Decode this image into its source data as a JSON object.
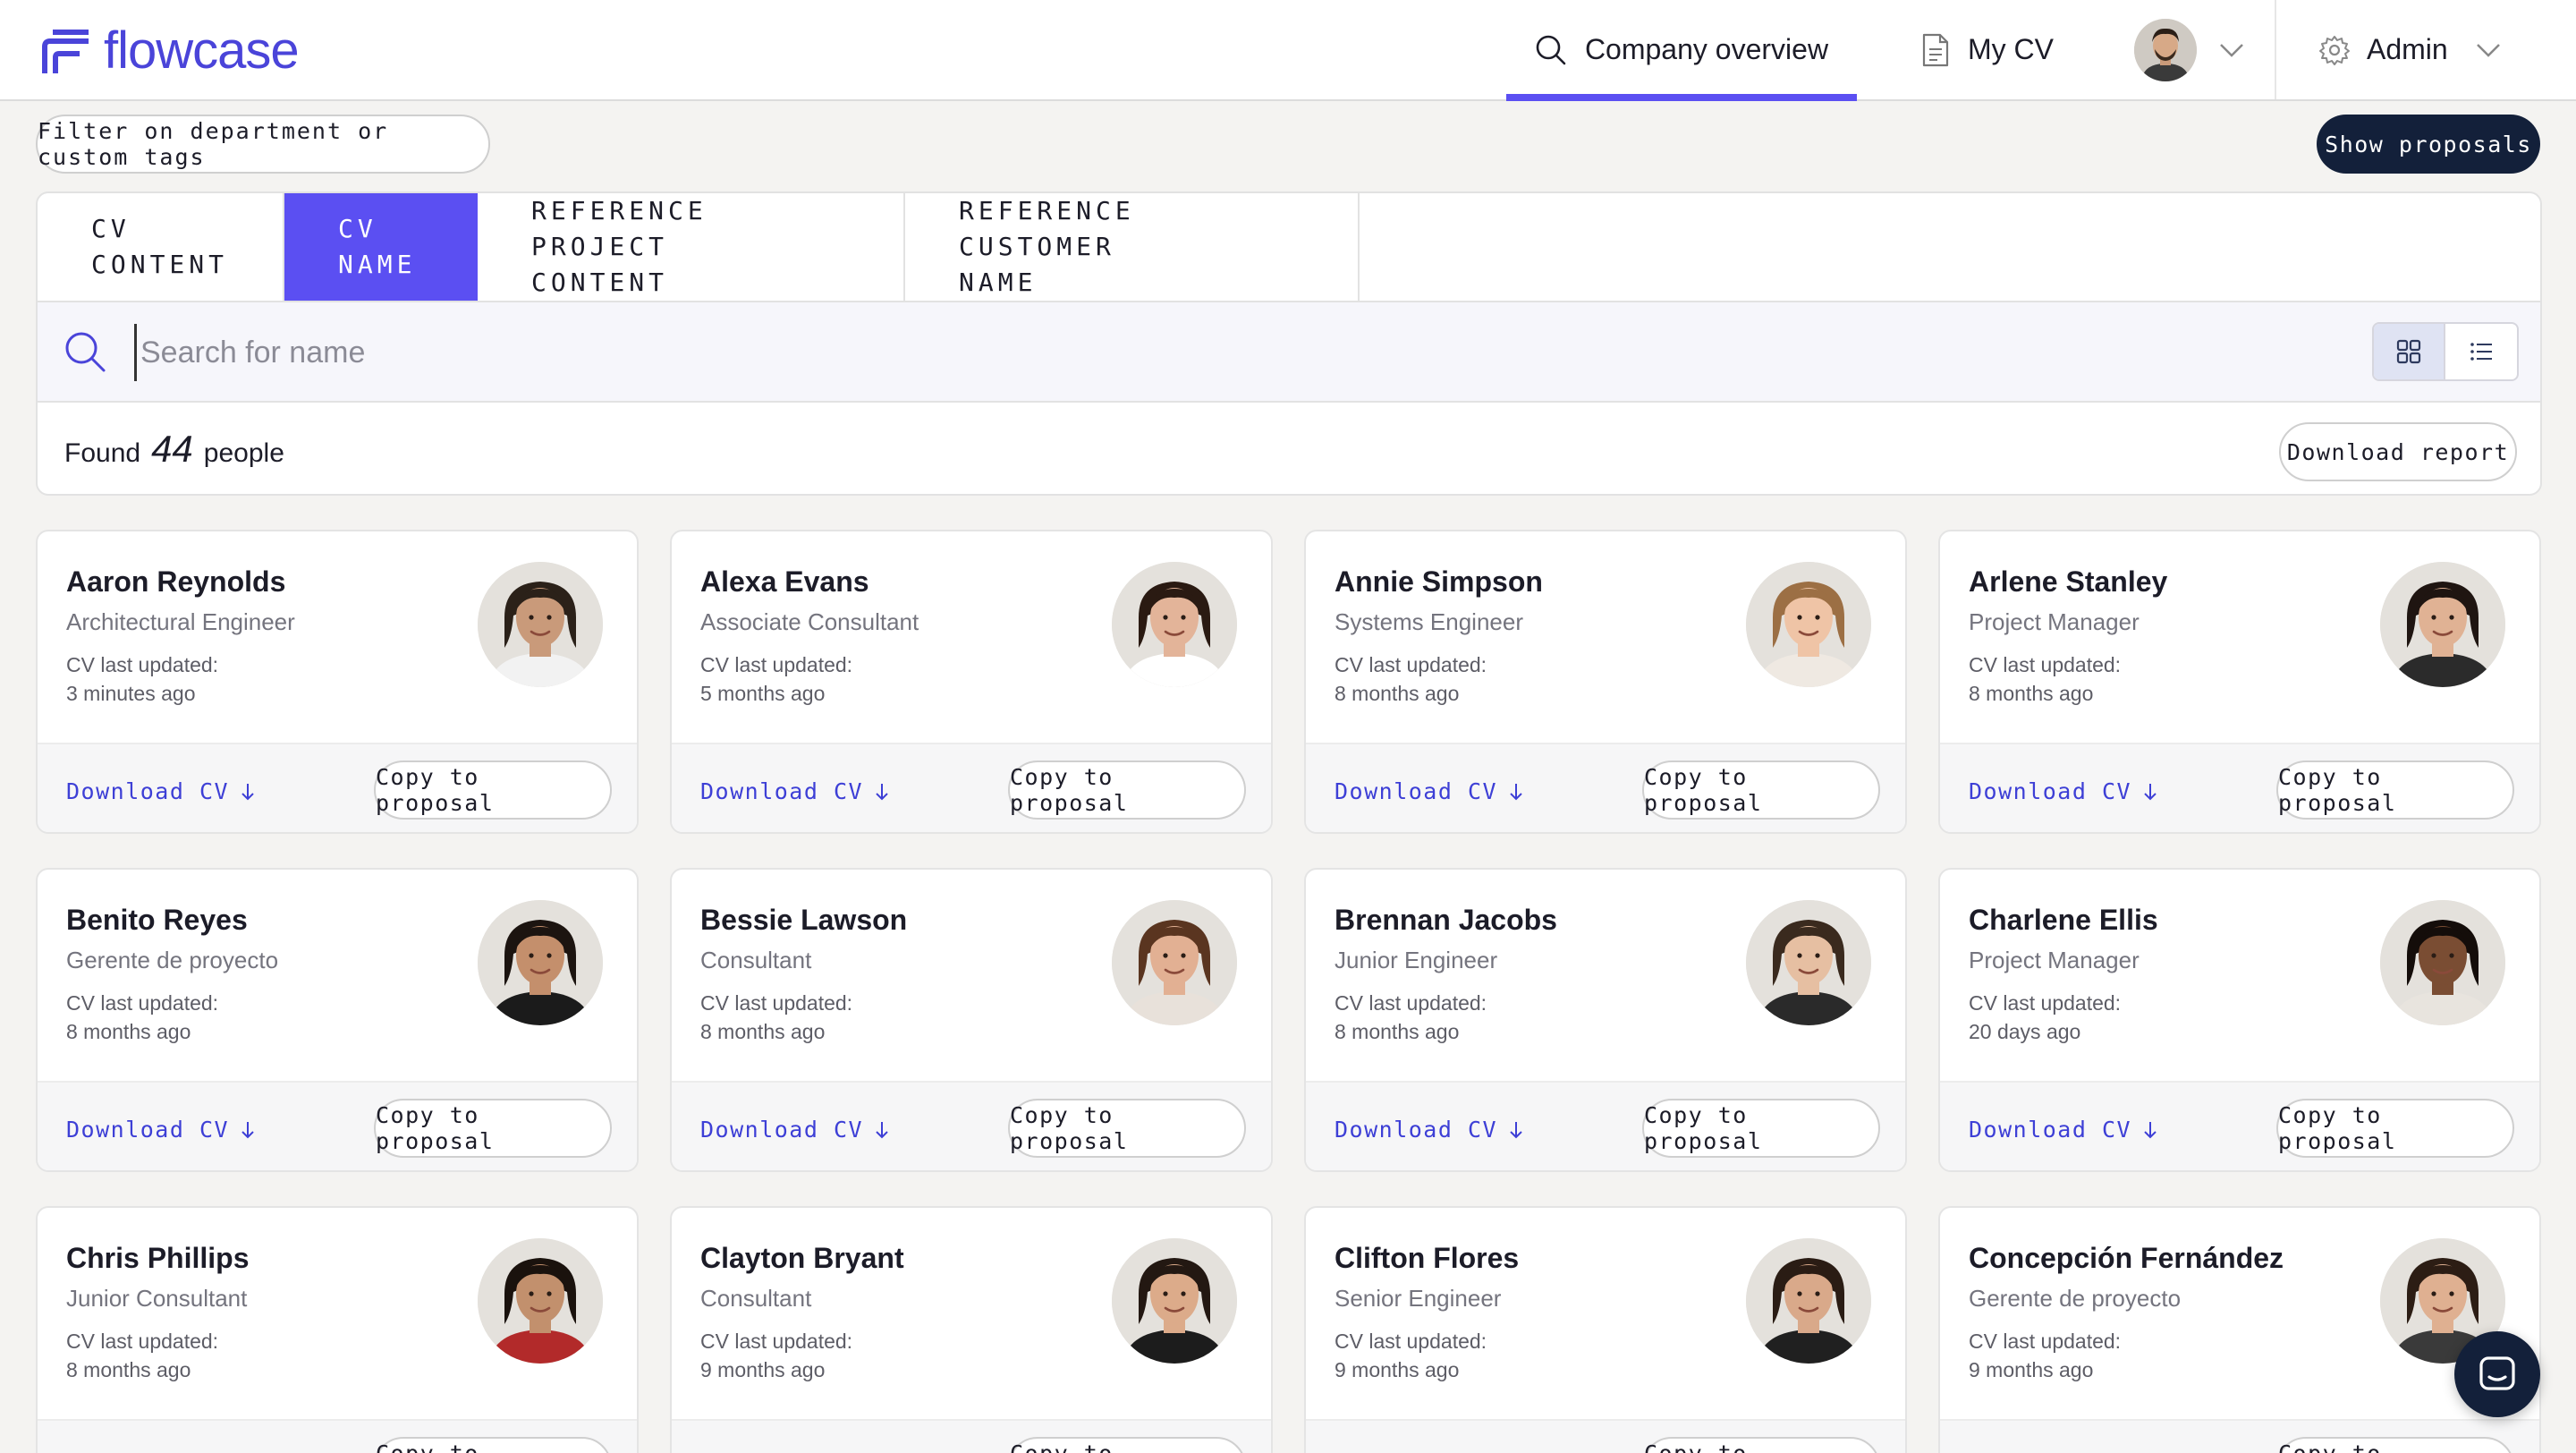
{
  "app": {
    "logo_text": "flowcase",
    "brand_color": "#5b4ff2"
  },
  "nav": {
    "company_overview": "Company overview",
    "my_cv": "My CV",
    "admin": "Admin"
  },
  "toolbar": {
    "filter_label": "Filter on department or custom tags",
    "show_proposals": "Show proposals"
  },
  "search": {
    "tabs": [
      {
        "line1": "CV",
        "line2": "CONTENT"
      },
      {
        "line1": "CV",
        "line2": "NAME"
      },
      {
        "line1": "REFERENCE PROJECT",
        "line2": "CONTENT"
      },
      {
        "line1": "REFERENCE CUSTOMER",
        "line2": "NAME"
      }
    ],
    "active_tab": 1,
    "placeholder": "Search for name",
    "value": "",
    "active_view": "grid"
  },
  "results": {
    "found_prefix": "Found",
    "count": "44",
    "found_suffix": "people",
    "download_report": "Download report"
  },
  "card_labels": {
    "cv_last_updated": "CV last updated:",
    "download_cv": "Download CV",
    "copy_to_proposal": "Copy to proposal"
  },
  "people": [
    {
      "name": "Aaron Reynolds",
      "role": "Architectural Engineer",
      "updated": "3 minutes ago",
      "skin": "#c99a7a",
      "hair": "#2b2119",
      "shirt": "#f2f2f2"
    },
    {
      "name": "Alexa Evans",
      "role": "Associate Consultant",
      "updated": "5 months ago",
      "skin": "#e3b499",
      "hair": "#2a1a12",
      "shirt": "#ffffff"
    },
    {
      "name": "Annie Simpson",
      "role": "Systems Engineer",
      "updated": "8 months ago",
      "skin": "#efc4a6",
      "hair": "#9c6f44",
      "shirt": "#efe9e2"
    },
    {
      "name": "Arlene Stanley",
      "role": "Project Manager",
      "updated": "8 months ago",
      "skin": "#e0b294",
      "hair": "#1f1511",
      "shirt": "#2b2b2b"
    },
    {
      "name": "Benito Reyes",
      "role": "Gerente de proyecto",
      "updated": "8 months ago",
      "skin": "#c48f6c",
      "hair": "#1c1410",
      "shirt": "#1b1b1b"
    },
    {
      "name": "Bessie Lawson",
      "role": "Consultant",
      "updated": "8 months ago",
      "skin": "#e2b093",
      "hair": "#5a3520",
      "shirt": "#e8e1da"
    },
    {
      "name": "Brennan Jacobs",
      "role": "Junior Engineer",
      "updated": "8 months ago",
      "skin": "#e6bfa2",
      "hair": "#3a2a1e",
      "shirt": "#2a2a2a"
    },
    {
      "name": "Charlene Ellis",
      "role": "Project Manager",
      "updated": "20 days ago",
      "skin": "#7a4d33",
      "hair": "#140d0a",
      "shirt": "#e8e4de"
    },
    {
      "name": "Chris Phillips",
      "role": "Junior Consultant",
      "updated": "8 months ago",
      "skin": "#c2906d",
      "hair": "#1a120d",
      "shirt": "#b22a2a"
    },
    {
      "name": "Clayton Bryant",
      "role": "Consultant",
      "updated": "9 months ago",
      "skin": "#dcab8a",
      "hair": "#231812",
      "shirt": "#1c1c1c"
    },
    {
      "name": "Clifton Flores",
      "role": "Senior Engineer",
      "updated": "9 months ago",
      "skin": "#d9a98a",
      "hair": "#2a1c14",
      "shirt": "#202020"
    },
    {
      "name": "Concepción Fernández",
      "role": "Gerente de proyecto",
      "updated": "9 months ago",
      "skin": "#dfb091",
      "hair": "#2c1d14",
      "shirt": "#3a3a3a"
    }
  ]
}
